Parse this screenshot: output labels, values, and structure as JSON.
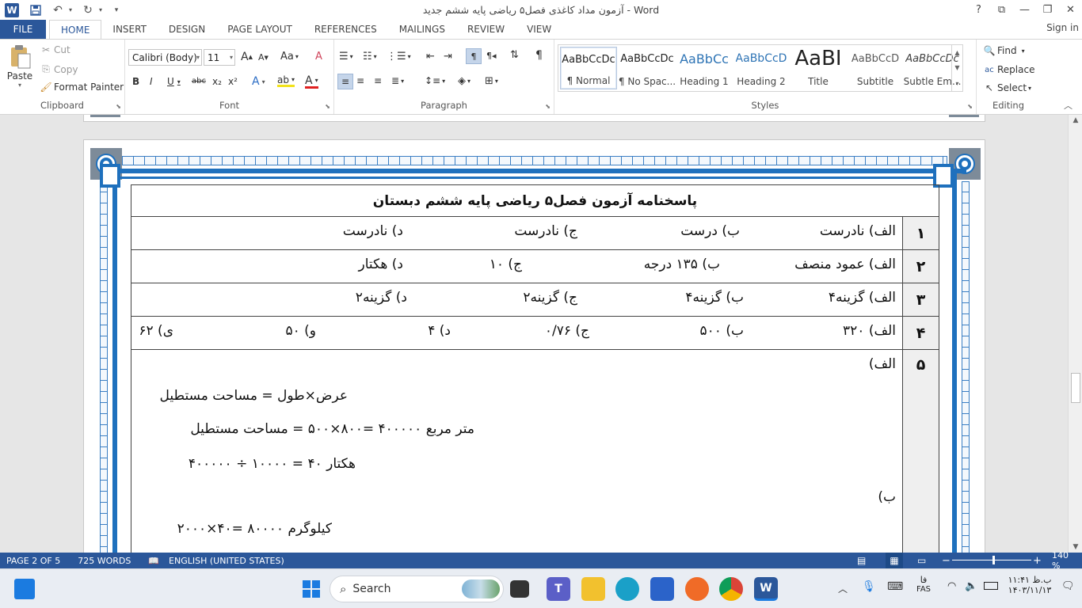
{
  "window": {
    "title": "آزمون مداد کاغذی فصل۵ ریاضی پایه ششم جدید - Word",
    "help": "?",
    "restore_ribbon": "⧉",
    "minimize": "—",
    "maximize": "❐",
    "close": "✕"
  },
  "qat": {
    "app_icon": "W",
    "save": "💾",
    "undo": "↶",
    "redo": "↻",
    "customize": "▾"
  },
  "tabs": [
    "FILE",
    "HOME",
    "INSERT",
    "DESIGN",
    "PAGE LAYOUT",
    "REFERENCES",
    "MAILINGS",
    "REVIEW",
    "VIEW"
  ],
  "signin": "Sign in",
  "ribbon": {
    "clipboard": {
      "paste": "Paste",
      "cut": "Cut",
      "copy": "Copy",
      "format_painter": "Format Painter",
      "label": "Clipboard"
    },
    "font": {
      "name": "Calibri (Body)",
      "size": "11",
      "label": "Font",
      "bold": "B",
      "italic": "I",
      "underline": "U",
      "strike": "abc",
      "sub": "x₂",
      "sup": "x²",
      "grow": "A",
      "shrink": "A",
      "case": "Aa",
      "clear": "A",
      "effects": "A",
      "highlight": "ab",
      "color": "A"
    },
    "paragraph": {
      "label": "Paragraph",
      "show_marks": "¶"
    },
    "styles": {
      "label": "Styles",
      "items": [
        {
          "sample": "AaBbCcDc",
          "name": "¶ Normal"
        },
        {
          "sample": "AaBbCcDc",
          "name": "¶ No Spac..."
        },
        {
          "sample": "AaBbCc",
          "name": "Heading 1"
        },
        {
          "sample": "AaBbCcD",
          "name": "Heading 2"
        },
        {
          "sample": "AaBI",
          "name": "Title"
        },
        {
          "sample": "AaBbCcD",
          "name": "Subtitle"
        },
        {
          "sample": "AaBbCcDc",
          "name": "Subtle Em..."
        }
      ]
    },
    "editing": {
      "find": "Find",
      "replace": "Replace",
      "select": "Select",
      "label": "Editing"
    }
  },
  "document": {
    "heading": "پاسخنامه آزمون فصل۵ ریاضی پایه ششم دبستان",
    "rows": [
      {
        "num": "۱",
        "answers": [
          "الف) نادرست",
          "ب) درست",
          "ج) نادرست",
          "د) نادرست"
        ]
      },
      {
        "num": "۲",
        "answers": [
          "الف) عمود منصف",
          "ب) ۱۳۵ درجه",
          "ج) ۱۰",
          "د) هکتار"
        ]
      },
      {
        "num": "۳",
        "answers": [
          "الف) گزینه۴",
          "ب) گزینه۴",
          "ج) گزینه۲",
          "د) گزینه۲"
        ]
      },
      {
        "num": "۴",
        "answers": [
          "الف) ۳۲۰",
          "ب) ۵۰۰",
          "ج) ۰/۷۶",
          "د) ۴",
          "و) ۵۰",
          "ی) ۶۲"
        ]
      }
    ],
    "row5": {
      "num": "۵",
      "part_a": "الف)",
      "line1": "عرض×طول = مساحت مستطیل",
      "line2": "متر مربع ۴۰۰۰۰۰ =۸۰۰×۵۰۰ = مساحت مستطیل",
      "line3": "هکتار ۴۰ = ۱۰۰۰۰ ÷ ۴۰۰۰۰۰",
      "part_b": "ب)",
      "line4": "کیلوگرم ۸۰۰۰۰ =۴۰×۲۰۰۰"
    }
  },
  "statusbar": {
    "page": "PAGE 2 OF 5",
    "words": "725 WORDS",
    "language": "ENGLISH (UNITED STATES)",
    "zoom": "140 %",
    "zoom_minus": "−",
    "zoom_plus": "+"
  },
  "taskbar": {
    "search": "Search",
    "lang": "فا",
    "lang_code": "FAS",
    "time": "۱۱:۴۱ ب.ظ",
    "date": "۱۴۰۳/۱۱/۱۳"
  }
}
